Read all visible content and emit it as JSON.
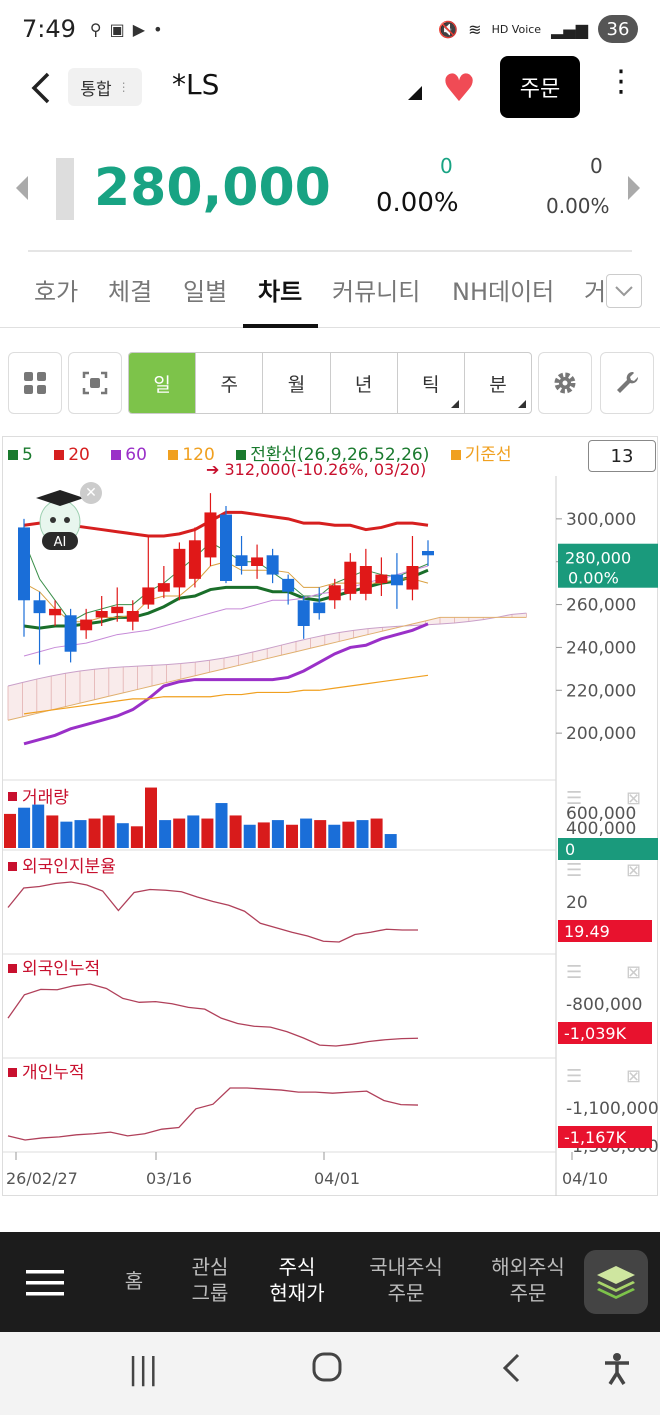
{
  "status": {
    "time": "7:49",
    "battery": "36",
    "signal_label": "HD Voice"
  },
  "header": {
    "tag_label": "통합",
    "stock_name": "*LS",
    "order_label": "주문"
  },
  "price": {
    "current": "280,000",
    "change_abs": "0",
    "change_pct": "0.00%",
    "sub_abs": "0",
    "sub_pct": "0.00%"
  },
  "tabs": [
    "호가",
    "체결",
    "일별",
    "차트",
    "커뮤니티",
    "NH데이터",
    "거"
  ],
  "periods": [
    "일",
    "주",
    "월",
    "년",
    "틱",
    "분"
  ],
  "chart_data": {
    "type": "candlestick",
    "legend": [
      "5",
      "20",
      "60",
      "120",
      "전환선(26,9,26,52,26)",
      "기준선"
    ],
    "legend_colors": [
      "#1a7a2e",
      "#d61f1f",
      "#9a30c8",
      "#f0a020",
      "#1a7a2e",
      "#f0a020"
    ],
    "high_note": "➔ 312,000(-10.26%, 03/20)",
    "count": "13",
    "yticks": [
      "300,000",
      "280,000",
      "260,000",
      "240,000",
      "220,000",
      "200,000"
    ],
    "ylim": [
      180000,
      320000
    ],
    "price_label": "280,000",
    "price_label_pct": "0.00%",
    "xlabels": [
      "26/02/27",
      "03/16",
      "04/01",
      "04/10"
    ],
    "candles": [
      {
        "o": 296000,
        "c": 262000,
        "h": 300000,
        "l": 245000
      },
      {
        "o": 262000,
        "c": 256000,
        "h": 266000,
        "l": 232000
      },
      {
        "o": 255000,
        "c": 258000,
        "h": 262000,
        "l": 250000
      },
      {
        "o": 255000,
        "c": 238000,
        "h": 258000,
        "l": 233000
      },
      {
        "o": 248000,
        "c": 253000,
        "h": 258000,
        "l": 244000
      },
      {
        "o": 254000,
        "c": 257000,
        "h": 264000,
        "l": 250000
      },
      {
        "o": 256000,
        "c": 259000,
        "h": 268000,
        "l": 252000
      },
      {
        "o": 252000,
        "c": 257000,
        "h": 262000,
        "l": 248000
      },
      {
        "o": 260000,
        "c": 268000,
        "h": 292000,
        "l": 258000
      },
      {
        "o": 266000,
        "c": 270000,
        "h": 278000,
        "l": 263000
      },
      {
        "o": 268000,
        "c": 286000,
        "h": 289000,
        "l": 262000
      },
      {
        "o": 272000,
        "c": 290000,
        "h": 296000,
        "l": 268000
      },
      {
        "o": 282000,
        "c": 303000,
        "h": 312000,
        "l": 278000
      },
      {
        "o": 302000,
        "c": 271000,
        "h": 306000,
        "l": 270000
      },
      {
        "o": 283000,
        "c": 278000,
        "h": 292000,
        "l": 274000
      },
      {
        "o": 278000,
        "c": 282000,
        "h": 288000,
        "l": 272000
      },
      {
        "o": 283000,
        "c": 274000,
        "h": 286000,
        "l": 270000
      },
      {
        "o": 272000,
        "c": 266000,
        "h": 274000,
        "l": 260000
      },
      {
        "o": 262000,
        "c": 250000,
        "h": 264000,
        "l": 244000
      },
      {
        "o": 261000,
        "c": 256000,
        "h": 268000,
        "l": 253000
      },
      {
        "o": 262000,
        "c": 269000,
        "h": 272000,
        "l": 258000
      },
      {
        "o": 265000,
        "c": 280000,
        "h": 284000,
        "l": 262000
      },
      {
        "o": 265000,
        "c": 278000,
        "h": 286000,
        "l": 262000
      },
      {
        "o": 270000,
        "c": 274000,
        "h": 282000,
        "l": 264000
      },
      {
        "o": 274000,
        "c": 269000,
        "h": 284000,
        "l": 258000
      },
      {
        "o": 267000,
        "c": 278000,
        "h": 292000,
        "l": 262000
      },
      {
        "o": 285000,
        "c": 283000,
        "h": 290000,
        "l": 278000
      }
    ],
    "volume": {
      "title": "거래량",
      "yticks": [
        "600,000",
        "400,000"
      ],
      "last": "0",
      "values": [
        440000,
        520000,
        560000,
        420000,
        340000,
        360000,
        380000,
        420000,
        320000,
        280000,
        780000,
        360000,
        380000,
        420000,
        380000,
        580000,
        420000,
        300000,
        330000,
        360000,
        300000,
        380000,
        360000,
        300000,
        340000,
        360000,
        380000,
        180000
      ],
      "colors": [
        "r",
        "b",
        "b",
        "r",
        "b",
        "b",
        "r",
        "r",
        "b",
        "r",
        "r",
        "b",
        "r",
        "b",
        "r",
        "b",
        "r",
        "b",
        "r",
        "b",
        "r",
        "b",
        "r",
        "b",
        "r",
        "b",
        "r",
        "b"
      ]
    },
    "subcharts": [
      {
        "title": "외국인지분율",
        "ytick": "20",
        "last": "19.49",
        "values": [
          20.2,
          22.8,
          23.0,
          23.4,
          23.6,
          23.2,
          22.4,
          19.8,
          22.2,
          22.6,
          22.5,
          22.3,
          21.6,
          21.0,
          20.5,
          19.7,
          18.1,
          17.5,
          16.9,
          16.4,
          15.7,
          15.6,
          16.6,
          16.9,
          17.3,
          17.2,
          17.2
        ]
      },
      {
        "title": "외국인누적",
        "ytick": "-800,000",
        "last": "-1,039K",
        "values": [
          -900000,
          -770000,
          -740000,
          -742000,
          -720000,
          -710000,
          -735000,
          -790000,
          -812000,
          -808000,
          -820000,
          -840000,
          -850000,
          -900000,
          -930000,
          -945000,
          -950000,
          -975000,
          -1010000,
          -1050000,
          -1055000,
          -1045000,
          -1030000,
          -1020000,
          -1014000,
          -1012000
        ]
      },
      {
        "title": "개인누적",
        "ytick": "-1,100,000",
        "ytick2": "-1,300,000",
        "last": "-1,167K",
        "values": [
          -1280000,
          -1300000,
          -1290000,
          -1285000,
          -1275000,
          -1270000,
          -1262000,
          -1280000,
          -1270000,
          -1248000,
          -1240000,
          -1150000,
          -1128000,
          -1050000,
          -1050000,
          -1055000,
          -1060000,
          -1070000,
          -1070000,
          -1075000,
          -1070000,
          -1065000,
          -1110000,
          -1130000,
          -1132000
        ]
      }
    ]
  },
  "bottom_nav": [
    "홈",
    "관심\n그룹",
    "주식\n현재가",
    "국내주식\n주문",
    "해외주식\n주문"
  ]
}
